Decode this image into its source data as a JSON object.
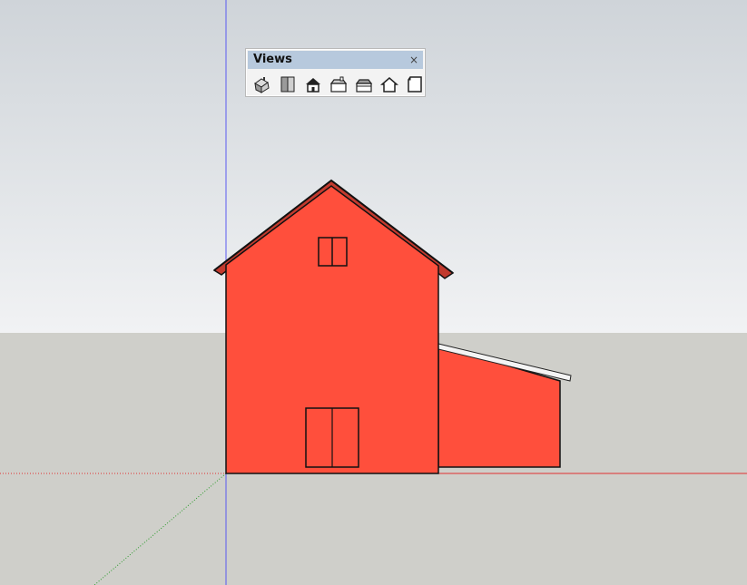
{
  "views_toolbar": {
    "title": "Views",
    "close_glyph": "×",
    "buttons": [
      {
        "name": "iso-view-button",
        "icon": "iso-house-icon"
      },
      {
        "name": "top-view-button",
        "icon": "top-view-icon"
      },
      {
        "name": "front-view-button",
        "icon": "front-house-icon"
      },
      {
        "name": "right-view-button",
        "icon": "right-house-icon"
      },
      {
        "name": "back-view-button",
        "icon": "back-house-icon"
      },
      {
        "name": "left-view-button",
        "icon": "left-house-icon"
      },
      {
        "name": "bottom-view-button",
        "icon": "bottom-view-icon"
      }
    ]
  },
  "colors": {
    "house_fill": "#ff4f3c",
    "outline": "#111111",
    "roof_underside": "#c0392b",
    "axis_blue": "#3c3cff",
    "axis_red": "#e02020",
    "axis_green": "#1a8a1a"
  }
}
